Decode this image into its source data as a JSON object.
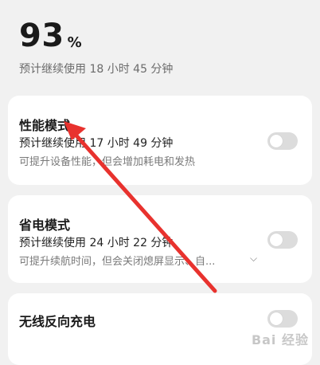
{
  "battery": {
    "percent": "93",
    "unit": "%",
    "remaining": "预计继续使用 18 小时 45 分钟"
  },
  "modes": [
    {
      "title": "性能模式",
      "estimate": "预计继续使用 17 小时 49 分钟",
      "description": "可提升设备性能，但会增加耗电和发热",
      "enabled": false
    },
    {
      "title": "省电模式",
      "estimate": "预计继续使用 24 小时 22 分钟",
      "description": "可提升续航时间，但会关闭熄屏显示、自...",
      "enabled": false
    },
    {
      "title": "无线反向充电",
      "enabled": false
    }
  ],
  "colors": {
    "background": "#f1f1f1",
    "card": "#ffffff",
    "toggle_off": "#dcdcdc",
    "annotation_arrow": "#e8322e"
  },
  "icons": {
    "expand": "chevron-down-icon"
  },
  "watermark": "Bai 经验"
}
